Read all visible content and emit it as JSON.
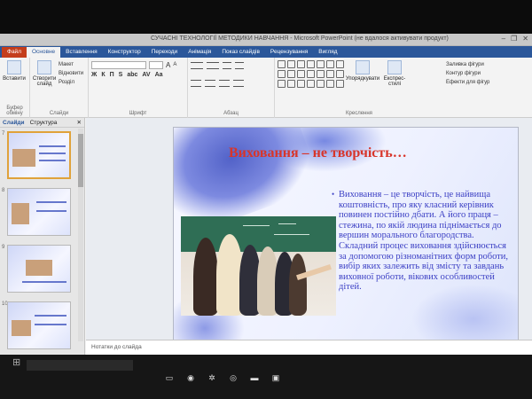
{
  "window": {
    "title": "СУЧАСНІ ТЕХНОЛОГІЇ МЕТОДИКИ НАВЧАННЯ - Microsoft PowerPoint (не вдалося активувати продукт)",
    "minimize_glyph": "–",
    "maximize_glyph": "❐",
    "close_glyph": "✕"
  },
  "ribbon_tabs": [
    {
      "label": "Файл"
    },
    {
      "label": "Основне"
    },
    {
      "label": "Вставлення"
    },
    {
      "label": "Конструктор"
    },
    {
      "label": "Переходи"
    },
    {
      "label": "Анімація"
    },
    {
      "label": "Показ слайдів"
    },
    {
      "label": "Рецензування"
    },
    {
      "label": "Вигляд"
    }
  ],
  "ribbon": {
    "clipboard": {
      "paste": "Вставити",
      "label": "Буфер обміну"
    },
    "slides": {
      "new_slide": "Створити слайд",
      "layout": "Макет",
      "reset": "Відновити",
      "section": "Розділ",
      "label": "Слайди"
    },
    "font": {
      "size_up": "A",
      "size_down": "A",
      "label": "Шрифт",
      "styles": [
        "Ж",
        "К",
        "П",
        "S",
        "abc",
        "AV",
        "Aa"
      ]
    },
    "paragraph": {
      "label": "Абзац"
    },
    "drawing": {
      "arrange": "Упорядкувати",
      "quick_styles": "Експрес-стилі",
      "fill": "Заливка фігури",
      "outline": "Контур фігури",
      "effects": "Ефекти для фігур",
      "label": "Креслення"
    }
  },
  "pane": {
    "tabs": [
      {
        "label": "Слайди"
      },
      {
        "label": "Структура"
      }
    ],
    "close_glyph": "✕",
    "thumbnails": [
      {
        "num": "7"
      },
      {
        "num": "8"
      },
      {
        "num": "9"
      },
      {
        "num": "10"
      }
    ]
  },
  "slide": {
    "title": "Виховання – не творчість…",
    "body": "Виховання – це творчість, це найвища коштовність, про яку класний керівник повинен постійно дбати. А його праця – стежина, по якій людина піднімається до вершин морального благородства. Складний процес виховання здійснюється за допомогою різноманітних форм роботи, вибір яких залежить від змісту та завдань виховної роботи, вікових особливостей дітей.",
    "bullet": "•"
  },
  "notes": {
    "placeholder": "Нотатки до слайда"
  },
  "taskbar": {
    "search_text": "",
    "icons": [
      {
        "name": "task-view-icon",
        "glyph": "▭"
      },
      {
        "name": "chrome-icon",
        "glyph": "◉"
      },
      {
        "name": "settings-icon",
        "glyph": "✲"
      },
      {
        "name": "globe-icon",
        "glyph": "◎"
      },
      {
        "name": "folder-icon",
        "glyph": "▬"
      },
      {
        "name": "powerpoint-icon",
        "glyph": "▣"
      }
    ]
  },
  "colors": {
    "ribbon_blue": "#2b579a",
    "file_tab": "#c43e1c",
    "slide_title": "#d8352a",
    "slide_text": "#3b3fc4"
  }
}
